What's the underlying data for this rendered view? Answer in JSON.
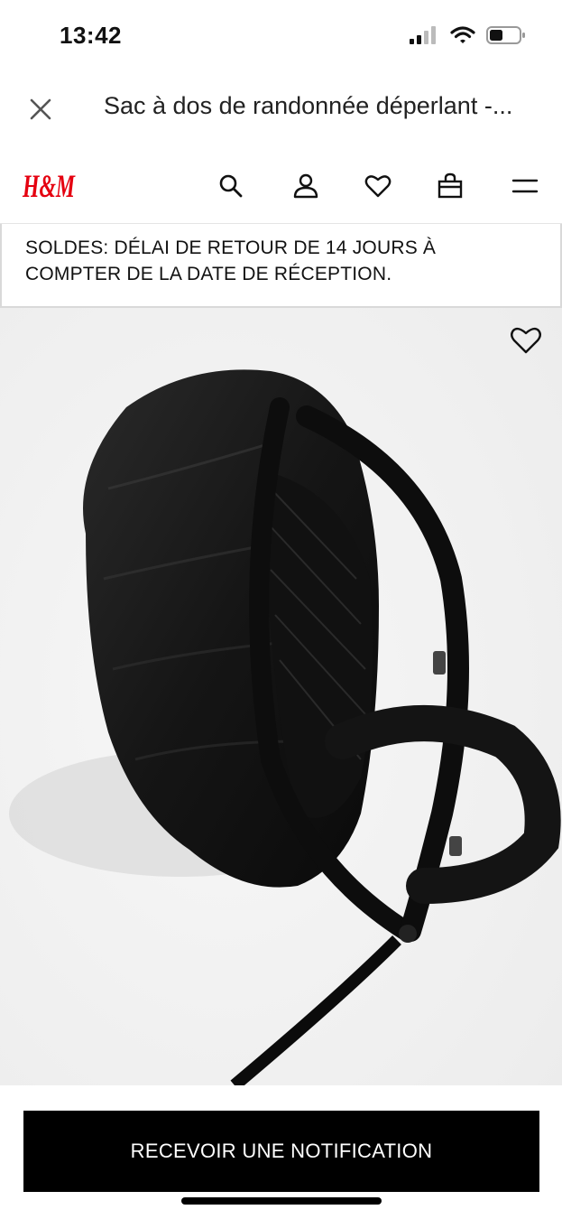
{
  "status_bar": {
    "time": "13:42",
    "icons": [
      "signal-icon",
      "wifi-icon",
      "battery-icon"
    ]
  },
  "browser": {
    "title": "Sac à dos de randonnée déperlant -..."
  },
  "nav": {
    "logo_text": "H&M",
    "icons": [
      "search-icon",
      "user-icon",
      "heart-icon",
      "bag-icon",
      "menu-icon"
    ],
    "brand_color": "#e50010"
  },
  "banner": {
    "text": "SOLDES: DÉLAI DE RETOUR DE 14 JOURS À COMPTER DE LA DATE DE RÉCEPTION."
  },
  "product": {
    "image_icon": "backpack-with-rain-cover",
    "favorite_icon": "heart-outline-icon"
  },
  "footer": {
    "cta_label": "RECEVOIR UNE NOTIFICATION"
  }
}
